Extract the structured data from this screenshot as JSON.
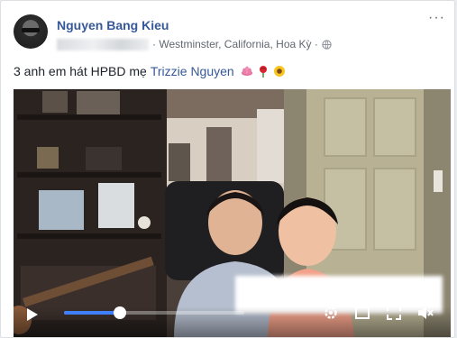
{
  "post": {
    "author_name": "Nguyen Bang Kieu",
    "location": "· Westminster, California, Hoa Kỳ ·",
    "more_label": "···",
    "caption_text": "3 anh em hát HPBD mẹ",
    "tagged_name": "Trizzie Nguyen",
    "caption_emojis": [
      "lotus-icon",
      "rose-icon",
      "sunflower-icon"
    ]
  },
  "video": {
    "progress": 0.31,
    "controls": [
      "play-icon",
      "settings-icon",
      "fullscreen-icon",
      "expand-icon",
      "mute-icon"
    ]
  },
  "colors": {
    "link": "#365899",
    "text": "#1d2129",
    "meta": "#616770",
    "progress_fill": "#4080ff"
  }
}
